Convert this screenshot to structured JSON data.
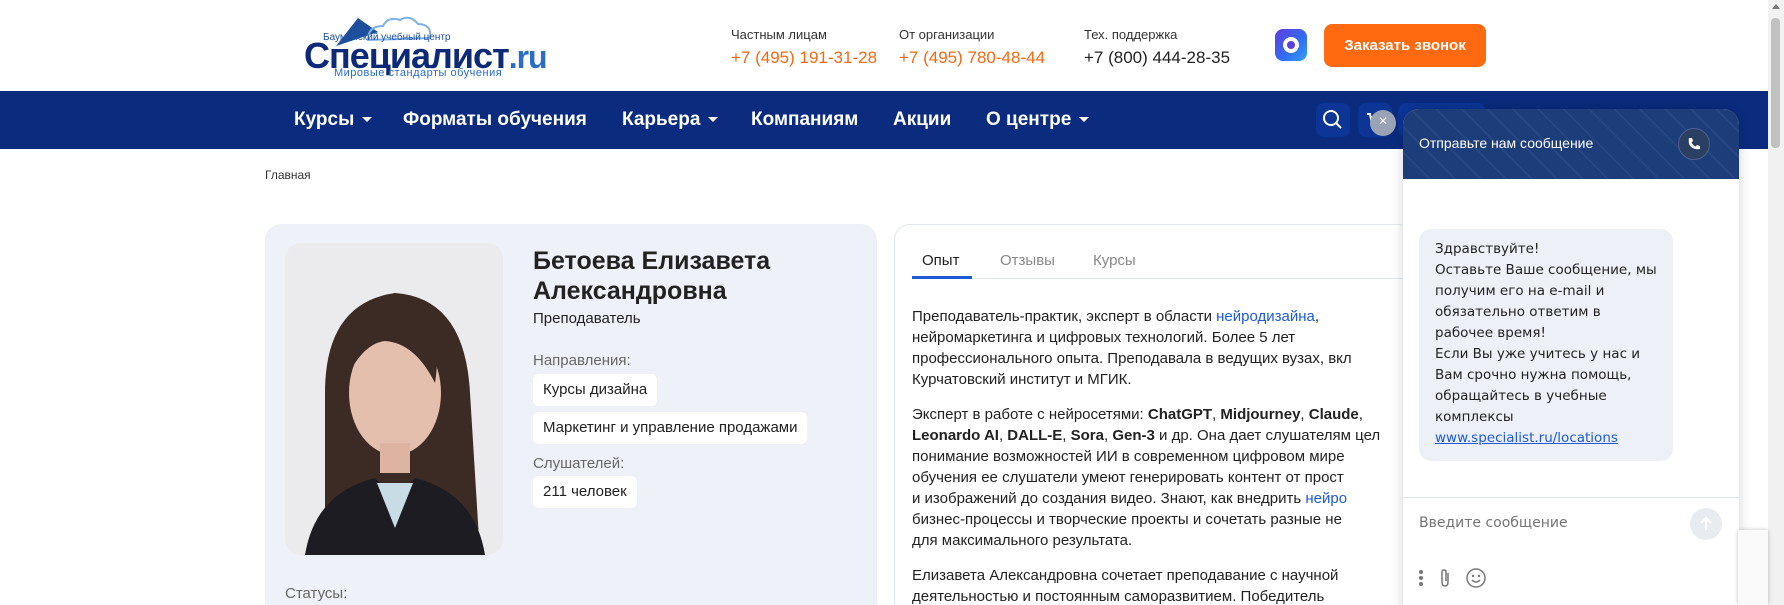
{
  "logo": {
    "top_text": "Бауманский учебный центр",
    "main_text": "Специалист",
    "ru_text": ".ru",
    "sub_text": "Мировые стандарты обучения"
  },
  "contacts": [
    {
      "label": "Частным лицам",
      "phone": "+7 (495) 191-31-28"
    },
    {
      "label": "От организации",
      "phone": "+7 (495) 780-48-44"
    },
    {
      "label": "Тех. поддержка",
      "phone": "+7 (800) 444-28-35"
    }
  ],
  "call_button": "Заказать звонок",
  "nav": [
    {
      "label": "Курсы"
    },
    {
      "label": "Форматы обучения"
    },
    {
      "label": "Карьера"
    },
    {
      "label": "Компаниям"
    },
    {
      "label": "Акции"
    },
    {
      "label": "О центре"
    }
  ],
  "breadcrumb": "Главная",
  "profile": {
    "name": "Бетоева Елизавета Александровна",
    "role": "Преподаватель",
    "directions_label": "Направления:",
    "directions": [
      "Курсы дизайна",
      "Маркетинг и управление продажами"
    ],
    "students_label": "Слушателей:",
    "students": "211 человек",
    "status_label": "Статусы:"
  },
  "tabs": [
    {
      "label": "Опыт",
      "active": true
    },
    {
      "label": "Отзывы",
      "active": false
    },
    {
      "label": "Курсы",
      "active": false
    }
  ],
  "experience": {
    "p1_a": "Преподаватель-практик, эксперт в области ",
    "p1_link": "нейродизайна",
    "p1_b": ",",
    "p1_c": "нейромаркетинга и цифровых технологий. Более 5 лет",
    "p1_d": "профессионального опыта. Преподавала в ведущих вузах, вкл",
    "p1_e": "Курчатовский институт и МГИК.",
    "p2_a": "Эксперт в работе с нейросетями: ",
    "p2_tools1": "ChatGPT",
    "p2_tools2": "Midjourney",
    "p2_tools3": "Claude",
    "p2_tools4": "Leonardo AI",
    "p2_tools5": "DALL-E",
    "p2_tools6": "Sora",
    "p2_tools7": "Gen-3",
    "p2_b": " и др. Она дает слушателям цел",
    "p2_c": "понимание возможностей ИИ в современном цифровом мире",
    "p2_d": "обучения ее слушатели умеют генерировать контент от прост",
    "p2_e": "и изображений до создания видео. Знают, как внедрить ",
    "p2_link": "нейро",
    "p2_f": "бизнес-процессы и творческие проекты и сочетать разные не",
    "p2_g": "для максимального результата.",
    "p3_a": "Елизавета Александровна сочетает преподавание с научной",
    "p3_b": "деятельностью и постоянным саморазвитием. Победитель"
  },
  "chat": {
    "title": "Отправьте нам сообщение",
    "close": "×",
    "message_lines": [
      "Здравствуйте!",
      "Оставьте Ваше сообщение, мы получим его на e-mail и обязательно ответим в рабочее время!",
      "Если Вы уже учитесь у нас и Вам срочно нужна помощь, обращайтесь в учебные комплексы"
    ],
    "link": "www.specialist.ru/locations",
    "input_placeholder": "Введите сообщение"
  },
  "colors": {
    "brand_navy": "#0a2b7e",
    "accent_orange": "#ff6a10",
    "link_blue": "#1e5ad6"
  }
}
